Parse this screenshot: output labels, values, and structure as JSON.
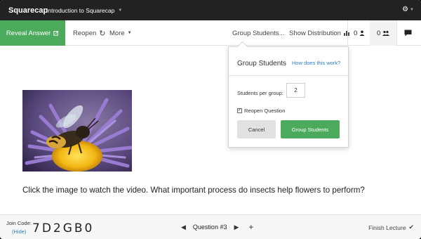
{
  "topbar": {
    "brand": "Squarecap",
    "lecture_title": "Introduction to Squarecap",
    "lecture_caret_icon": "caret-down-icon",
    "settings_icon": "gear-icon"
  },
  "toolbar": {
    "reveal_answer": "Reveal Answer",
    "reopen": "Reopen",
    "more": "More",
    "group_students": "Group Students...",
    "show_distribution": "Show Distribution",
    "count_single": "0",
    "count_group": "0"
  },
  "popover": {
    "title": "Group Students",
    "help_link": "How does this work?",
    "students_per_group_label": "Students per group:",
    "students_per_group_value": "2",
    "reopen_label": "Reopen Question",
    "reopen_checked": true,
    "cancel": "Cancel",
    "submit": "Group Students"
  },
  "question": {
    "image": "bee-on-purple-aster-flower",
    "text": "Click the image to watch the video. What important process do insects help flowers to perform?"
  },
  "footer": {
    "join_code_label": "Join Code:",
    "hide_link": "(Hide)",
    "join_code": "7D2GB0",
    "question_label": "Question #3",
    "finish": "Finish Lecture"
  },
  "colors": {
    "green": "#4caa5c",
    "topbar": "#222222",
    "link": "#2e7fbf"
  }
}
